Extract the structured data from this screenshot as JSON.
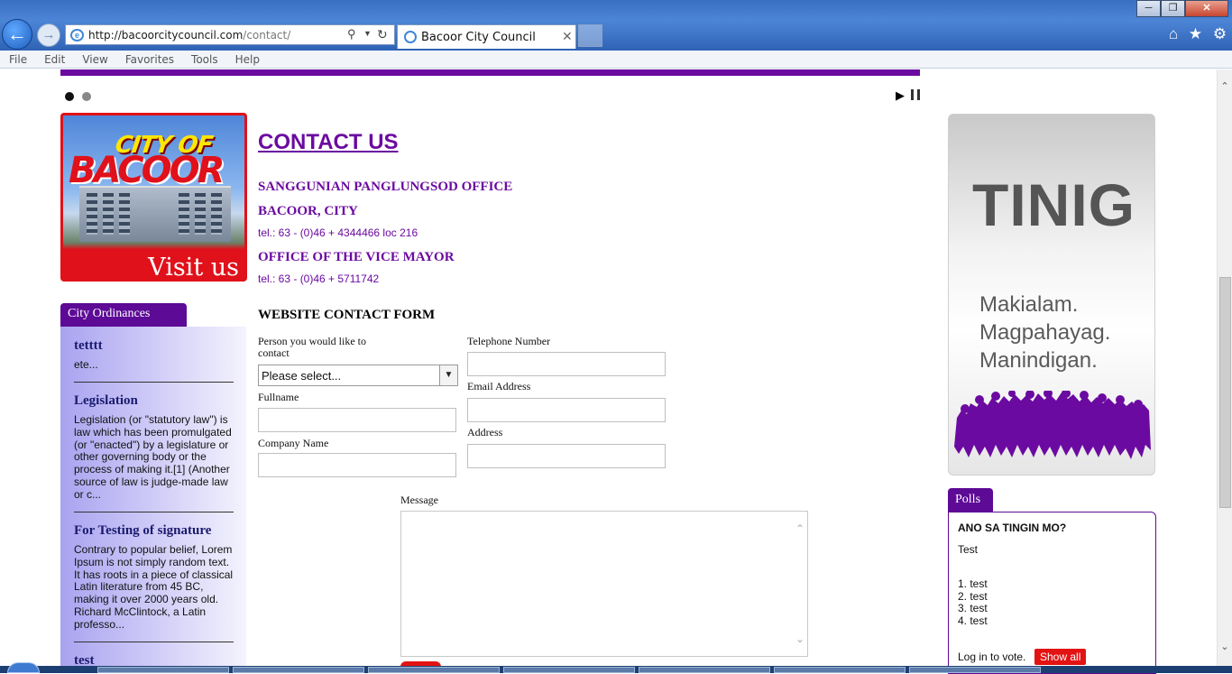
{
  "browser": {
    "url_host": "http://bacoorcitycouncil.com",
    "url_path": "/contact/",
    "tab_title": "Bacoor City Council",
    "menu": [
      "File",
      "Edit",
      "View",
      "Favorites",
      "Tools",
      "Help"
    ]
  },
  "banner": {
    "city_of": "CITY OF",
    "bacoor": "BACOOR",
    "visit_us": "Visit us"
  },
  "ordinances": {
    "tab_label": "City Ordinances",
    "items": [
      {
        "title": "tetttt",
        "body": "ete..."
      },
      {
        "title": "Legislation",
        "body": "Legislation (or \"statutory law\") is law which has been promulgated (or \"enacted\") by a legislature or other governing body or the process of making it.[1] (Another source of law is judge-made law or c..."
      },
      {
        "title": "For Testing of signature",
        "body": "Contrary to popular belief, Lorem Ipsum is not simply random text. It has roots in a piece of classical Latin literature from 45 BC, making it over 2000 years old. Richard McClintock, a Latin professo..."
      },
      {
        "title": "test",
        "body": ""
      }
    ]
  },
  "contact": {
    "title": "CONTACT US",
    "office1_line1": "SANGGUNIAN PANGLUNGSOD OFFICE",
    "office1_line2": "BACOOR, CITY",
    "office1_tel": "tel.: 63 - (0)46 + 4344466 loc 216",
    "office2_line1": "OFFICE OF THE VICE MAYOR",
    "office2_tel": "tel.: 63 - (0)46 + 5711742"
  },
  "form": {
    "title": "WEBSITE CONTACT FORM",
    "person_label": "Person you would like to contact",
    "person_value": "Please select...",
    "fullname_label": "Fullname",
    "company_label": "Company Name",
    "telephone_label": "Telephone Number",
    "email_label": "Email Address",
    "address_label": "Address",
    "message_label": "Message"
  },
  "tinig": {
    "title": "TINIG",
    "line1": "Makialam.",
    "line2": "Magpahayag.",
    "line3": "Manindigan."
  },
  "polls": {
    "tab_label": "Polls",
    "question": "ANO SA TINGIN MO?",
    "description": "Test",
    "options": [
      "1. test",
      "2. test",
      "3. test",
      "4. test"
    ],
    "login_text": "Log in to vote.",
    "show_all": "Show all"
  },
  "colors": {
    "accent_purple": "#6b0aa0",
    "button_red": "#e31313"
  }
}
